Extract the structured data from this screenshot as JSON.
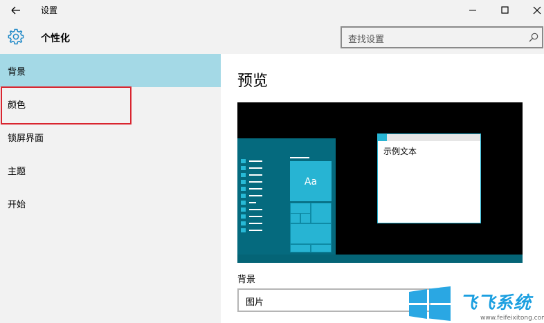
{
  "window": {
    "title": "设置",
    "controls": [
      "minimize-icon",
      "maximize-icon",
      "close-icon"
    ]
  },
  "header": {
    "title": "个性化",
    "icon": "gear-icon"
  },
  "search": {
    "placeholder": "查找设置",
    "icon": "search-icon"
  },
  "sidebar": {
    "items": [
      {
        "label": "背景",
        "active": true
      },
      {
        "label": "颜色",
        "active": false
      },
      {
        "label": "锁屏界面",
        "active": false
      },
      {
        "label": "主题",
        "active": false
      },
      {
        "label": "开始",
        "active": false
      }
    ]
  },
  "main": {
    "preview_title": "预览",
    "preview": {
      "tile_text": "Aa",
      "sample_text": "示例文本"
    },
    "background_label": "背景",
    "background_select": "图片"
  },
  "watermark": {
    "text": "飞飞系统",
    "url": "www.feifeixitong.com"
  },
  "colors": {
    "accent": "#a4d9e6",
    "tile": "#27b4d3",
    "start_menu": "#056a7e",
    "highlight_border": "#d9252f",
    "watermark": "#1b9fe0"
  }
}
